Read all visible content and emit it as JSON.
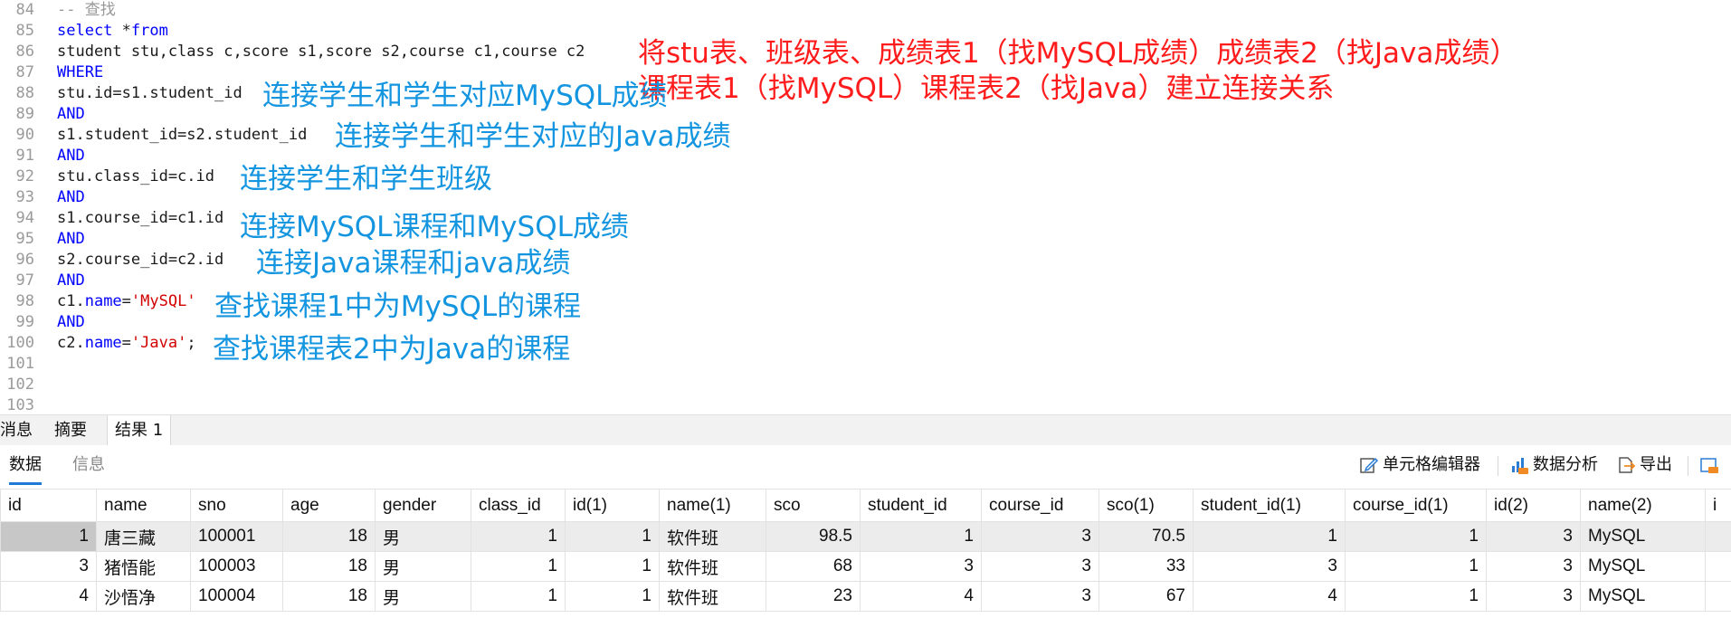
{
  "editor": {
    "lines": [
      {
        "n": "84",
        "segments": [
          {
            "t": "-- 查找",
            "c": "cmt"
          }
        ]
      },
      {
        "n": "85",
        "segments": [
          {
            "t": "select",
            "c": "kw"
          },
          {
            "t": " *",
            "c": ""
          },
          {
            "t": "from",
            "c": "kw"
          }
        ]
      },
      {
        "n": "86",
        "segments": [
          {
            "t": "student stu,class c,score s1,score s2,course c1,course c2",
            "c": ""
          }
        ]
      },
      {
        "n": "87",
        "segments": [
          {
            "t": "WHERE",
            "c": "kw"
          }
        ]
      },
      {
        "n": "88",
        "segments": [
          {
            "t": "stu.id=s1.student_id",
            "c": ""
          }
        ]
      },
      {
        "n": "89",
        "segments": [
          {
            "t": "AND",
            "c": "kw"
          }
        ]
      },
      {
        "n": "90",
        "segments": [
          {
            "t": "s1.student_id=s2.student_id",
            "c": ""
          }
        ]
      },
      {
        "n": "91",
        "segments": [
          {
            "t": "AND",
            "c": "kw"
          }
        ]
      },
      {
        "n": "92",
        "segments": [
          {
            "t": "stu.class_id=c.id",
            "c": ""
          }
        ]
      },
      {
        "n": "93",
        "segments": [
          {
            "t": "AND",
            "c": "kw"
          }
        ]
      },
      {
        "n": "94",
        "segments": [
          {
            "t": "s1.course_id=c1.id",
            "c": ""
          }
        ]
      },
      {
        "n": "95",
        "segments": [
          {
            "t": "AND",
            "c": "kw"
          }
        ]
      },
      {
        "n": "96",
        "segments": [
          {
            "t": "s2.course_id=c2.id",
            "c": ""
          }
        ]
      },
      {
        "n": "97",
        "segments": [
          {
            "t": "AND",
            "c": "kw"
          }
        ]
      },
      {
        "n": "98",
        "segments": [
          {
            "t": "c1.",
            "c": ""
          },
          {
            "t": "name",
            "c": "kw"
          },
          {
            "t": "=",
            "c": ""
          },
          {
            "t": "'MySQL'",
            "c": "str"
          }
        ]
      },
      {
        "n": "99",
        "segments": [
          {
            "t": "AND",
            "c": "kw"
          }
        ]
      },
      {
        "n": "100",
        "segments": [
          {
            "t": "c2.",
            "c": ""
          },
          {
            "t": "name",
            "c": "kw"
          },
          {
            "t": "=",
            "c": ""
          },
          {
            "t": "'Java'",
            "c": "str"
          },
          {
            "t": ";",
            "c": ""
          }
        ]
      },
      {
        "n": "101",
        "segments": []
      },
      {
        "n": "102",
        "segments": []
      },
      {
        "n": "103",
        "segments": []
      }
    ],
    "annotations": {
      "red_line1": "将stu表、班级表、成绩表1（找MySQL成绩）成绩表2（找Java成绩）",
      "red_line2": "课程表1（找MySQL）课程表2（找Java）建立连接关系",
      "blue_88": "连接学生和学生对应MySQL成绩",
      "blue_90": "连接学生和学生对应的Java成绩",
      "blue_92": "连接学生和学生班级",
      "blue_94": "连接MySQL课程和MySQL成绩",
      "blue_96": "连接Java课程和java成绩",
      "blue_98": "查找课程1中为MySQL的课程",
      "blue_100": "查找课程表2中为Java的课程"
    },
    "colors": {
      "keyword": "#0000ff",
      "string": "#d30000",
      "annotation_blue": "#1495e0",
      "annotation_red": "#ff1c1c"
    }
  },
  "panel_tabs": [
    {
      "label": "消息",
      "active": false
    },
    {
      "label": "摘要",
      "active": false
    },
    {
      "label": "结果 1",
      "active": true
    }
  ],
  "sub_tabs": [
    {
      "label": "数据",
      "active": true
    },
    {
      "label": "信息",
      "active": false
    }
  ],
  "toolbar": {
    "cell_editor": "单元格编辑器",
    "data_analysis": "数据分析",
    "export": "导出"
  },
  "grid": {
    "columns": [
      "id",
      "name",
      "sno",
      "age",
      "gender",
      "class_id",
      "id(1)",
      "name(1)",
      "sco",
      "student_id",
      "course_id",
      "sco(1)",
      "student_id(1)",
      "course_id(1)",
      "id(2)",
      "name(2)",
      "i"
    ],
    "rows": [
      [
        "1",
        "唐三藏",
        "100001",
        "18",
        "男",
        "1",
        "1",
        "软件班",
        "98.5",
        "1",
        "3",
        "70.5",
        "1",
        "1",
        "3",
        "MySQL",
        ""
      ],
      [
        "3",
        "猪悟能",
        "100003",
        "18",
        "男",
        "1",
        "1",
        "软件班",
        "68",
        "3",
        "3",
        "33",
        "3",
        "1",
        "3",
        "MySQL",
        ""
      ],
      [
        "4",
        "沙悟净",
        "100004",
        "18",
        "男",
        "1",
        "1",
        "软件班",
        "23",
        "4",
        "3",
        "67",
        "4",
        "1",
        "3",
        "MySQL",
        ""
      ]
    ],
    "selected_row": 0
  }
}
